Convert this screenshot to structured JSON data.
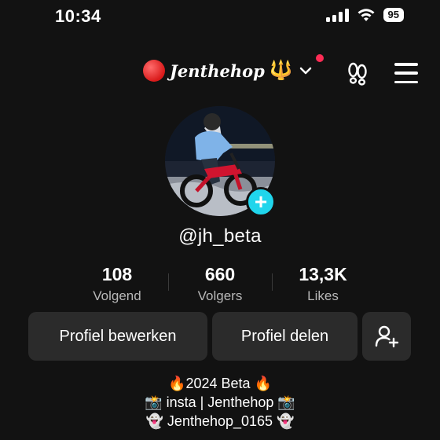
{
  "status_bar": {
    "time": "10:34",
    "battery": "95"
  },
  "header": {
    "title": "Jenthehop",
    "title_prefix_icon": "red-circle",
    "title_suffix_icon": "trident-emoji",
    "icons": [
      "chevron-down-icon",
      "footprints-icon",
      "menu-icon"
    ]
  },
  "profile": {
    "handle": "@jh_beta",
    "stats": [
      {
        "value": "108",
        "label": "Volgend"
      },
      {
        "value": "660",
        "label": "Volgers"
      },
      {
        "value": "13,3K",
        "label": "Likes"
      }
    ]
  },
  "actions": {
    "edit_label": "Profiel bewerken",
    "share_label": "Profiel delen",
    "add_friend_icon": "add-person-icon"
  },
  "bio": [
    "🔥2024 Beta 🔥",
    "📸 insta | Jenthehop 📸",
    "👻 Jenthehop_0165 👻"
  ],
  "colors": {
    "background": "#121212",
    "button_bg": "#2b2b2b",
    "accent_cyan": "#20d5ec",
    "notification": "#fe2c55",
    "secondary_text": "#b8b8b8"
  }
}
